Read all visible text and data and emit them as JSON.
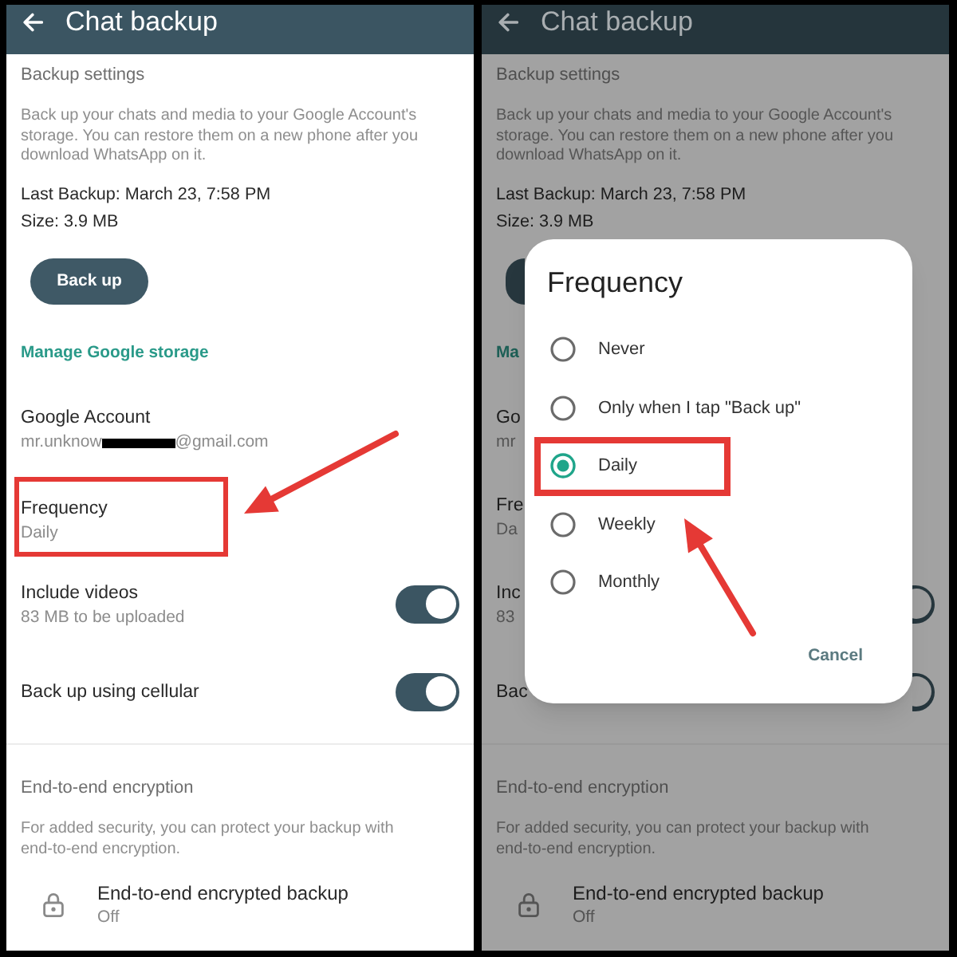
{
  "screens": [
    {
      "dimmed": false,
      "header": {
        "title": "Chat backup"
      },
      "items": [
        {
          "kind": "heading",
          "text": "Backup settings"
        },
        {
          "kind": "note",
          "text": "Back up your chats and media to your Google Account's storage. You can restore them on a new phone after you download WhatsApp on it."
        },
        {
          "kind": "info",
          "text": "Last Backup: March 23, 7:58 PM"
        },
        {
          "kind": "info",
          "text": "Size: 3.9 MB"
        },
        {
          "kind": "button",
          "label": "Back up"
        },
        {
          "kind": "link",
          "text": "Manage Google storage"
        },
        {
          "kind": "setting",
          "title": "Google Account",
          "subtitle": "mr.unknow",
          "redacted": true,
          "subtitle_end": "@gmail.com",
          "highlighted": false
        },
        {
          "kind": "setting",
          "title": "Frequency",
          "subtitle": "Daily",
          "highlighted": true
        },
        {
          "kind": "setting",
          "title": "Include videos",
          "subtitle": "83 MB to be uploaded",
          "toggle": {
            "on": true
          },
          "highlighted": false
        },
        {
          "kind": "setting",
          "title": "Back up using cellular",
          "toggle": {
            "on": true
          },
          "highlighted": false
        },
        {
          "kind": "divider"
        },
        {
          "kind": "heading",
          "text": "End-to-end encryption"
        },
        {
          "kind": "note",
          "text": "For added security, you can protect your backup with end-to-end encryption."
        },
        {
          "kind": "lock_setting",
          "title": "End-to-end encrypted backup",
          "subtitle": "Off"
        }
      ]
    },
    {
      "dimmed": true,
      "header": {
        "title": "Chat backup"
      },
      "items": [
        {
          "kind": "heading",
          "text": "Backup settings"
        },
        {
          "kind": "note",
          "text": "Back up your chats and media to your Google Account's storage. You can restore them on a new phone after you download WhatsApp on it."
        },
        {
          "kind": "info",
          "text": "Last Backup: March 23, 7:58 PM"
        },
        {
          "kind": "info",
          "text": "Size: 3.9 MB"
        },
        {
          "kind": "button"
        },
        {
          "kind": "link",
          "text": "Ma"
        },
        {
          "kind": "setting",
          "title": "Go",
          "subtitle": "mr",
          "redacted": false,
          "highlighted": false
        },
        {
          "kind": "setting",
          "title": "Fre",
          "subtitle": "Da",
          "highlighted": false
        },
        {
          "kind": "setting",
          "title": "Inc",
          "subtitle": "83",
          "toggle": {
            "on": true
          },
          "highlighted": false
        },
        {
          "kind": "setting",
          "title": "Bac",
          "toggle": {
            "on": true
          },
          "highlighted": false
        },
        {
          "kind": "divider"
        },
        {
          "kind": "heading",
          "text": "End-to-end encryption"
        },
        {
          "kind": "note",
          "text": "For added security, you can protect your backup with end-to-end encryption."
        },
        {
          "kind": "lock_setting",
          "title": "End-to-end encrypted backup",
          "subtitle": "Off"
        }
      ],
      "dialog": {
        "title": "Frequency",
        "options": [
          {
            "label": "Never",
            "selected": false,
            "highlighted": false
          },
          {
            "label": "Only when I tap \"Back up\"",
            "selected": false,
            "highlighted": false
          },
          {
            "label": "Daily",
            "selected": true,
            "highlighted": true
          },
          {
            "label": "Weekly",
            "selected": false,
            "highlighted": false
          },
          {
            "label": "Monthly",
            "selected": false,
            "highlighted": false
          }
        ],
        "actions": [
          "Cancel"
        ]
      }
    }
  ]
}
